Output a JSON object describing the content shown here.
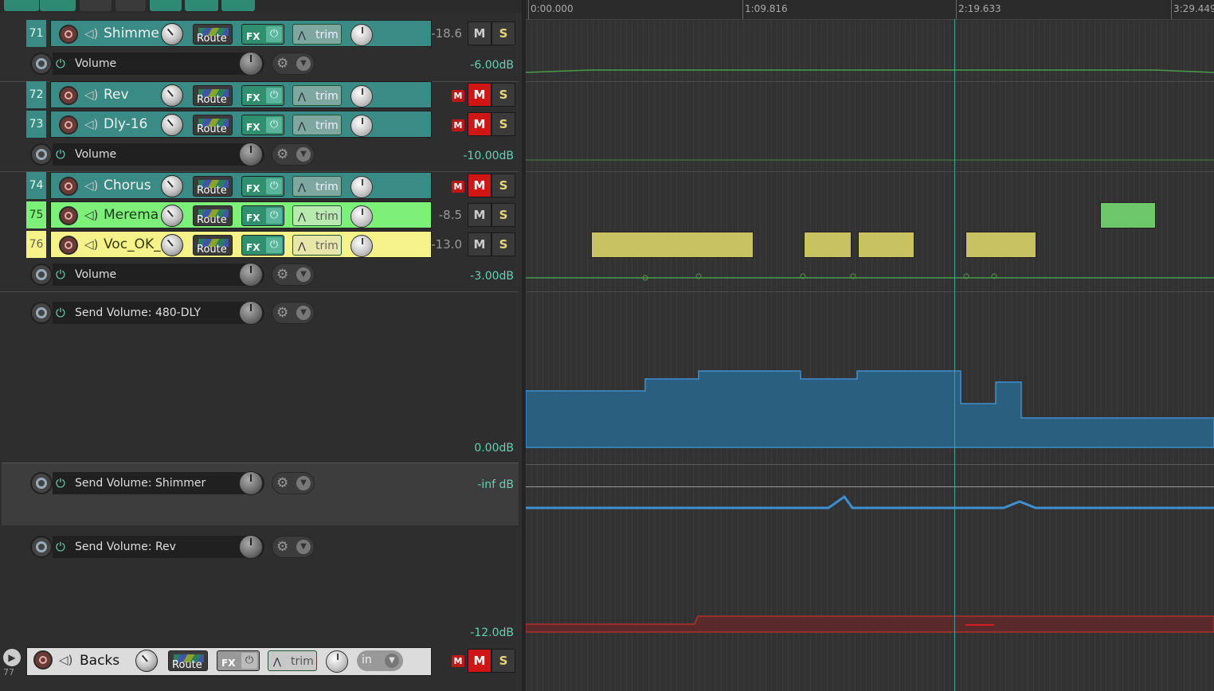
{
  "tracks": [
    {
      "num": "71",
      "name": "Shimme",
      "volume": "-18.6",
      "mute_on": false,
      "mini_mute": false,
      "color": "#3a8a86"
    },
    {
      "num": "72",
      "name": "Rev",
      "volume": "",
      "mute_on": true,
      "mini_mute": true,
      "color": "#3a8a86"
    },
    {
      "num": "73",
      "name": "Dly-16",
      "volume": "",
      "mute_on": true,
      "mini_mute": true,
      "color": "#3a8a86"
    },
    {
      "num": "74",
      "name": "Chorus",
      "volume": "",
      "mute_on": true,
      "mini_mute": true,
      "color": "#3a8a86"
    },
    {
      "num": "75",
      "name": "Merema",
      "volume": "-8.5",
      "mute_on": false,
      "mini_mute": false,
      "color": "#7df07a"
    },
    {
      "num": "76",
      "name": "Voc_OK_",
      "volume": "-13.0",
      "mute_on": false,
      "mini_mute": false,
      "color": "#f5f28a"
    }
  ],
  "buttons": {
    "route": "Route",
    "fx": "FX",
    "trim": "trim",
    "mute": "M",
    "solo": "S",
    "mini_mute": "M",
    "in": "in"
  },
  "envelopes": [
    {
      "label": "Volume",
      "value": "-6.00dB"
    },
    {
      "label": "Volume",
      "value": "-10.00dB"
    },
    {
      "label": "Volume",
      "value": "-3.00dB"
    },
    {
      "label": "Send Volume: 480-DLY",
      "value": "0.00dB"
    },
    {
      "label": "Send Volume: Shimmer",
      "value": "-inf dB"
    },
    {
      "label": "Send Volume: Rev",
      "value": "-12.0dB"
    }
  ],
  "folder_track": {
    "num": "77",
    "name": "Backs"
  },
  "ruler": {
    "labels": [
      "0:00.000",
      "1:09.816",
      "2:19.633",
      "3:29.449"
    ]
  },
  "colors": {
    "accent": "#2f8f6e",
    "mute_red": "#d01515",
    "env_green": "#4a9a4a",
    "env_blue": "#3d8fd0",
    "env_red": "#b03030"
  }
}
